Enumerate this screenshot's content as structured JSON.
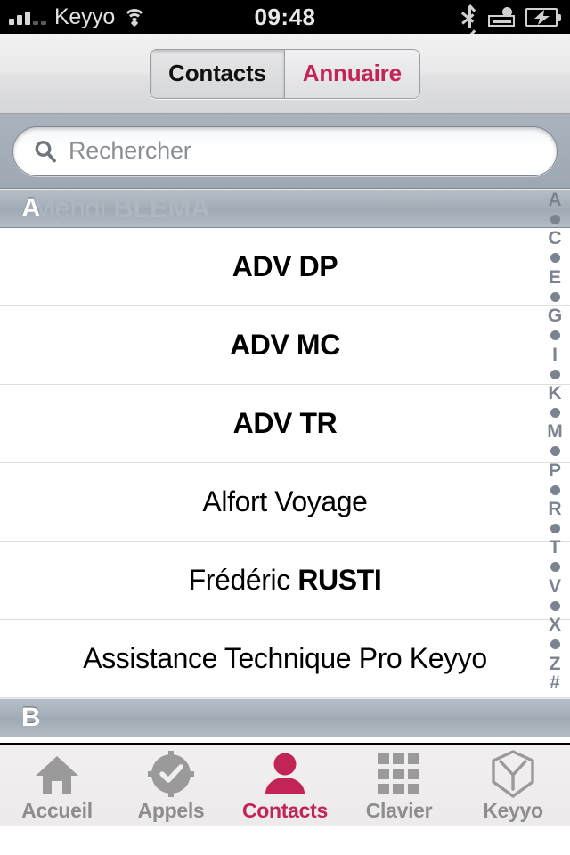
{
  "status_bar": {
    "carrier": "Keyyo",
    "time": "09:48",
    "signal_icon": "signal-bars-icon",
    "wifi_icon": "wifi-icon",
    "bluetooth_icon": "bluetooth-icon",
    "lock_icon": "lock-rotation-icon",
    "battery_icon": "battery-charging-icon"
  },
  "navbar": {
    "segments": [
      {
        "label": "Contacts",
        "selected": true
      },
      {
        "label": "Annuaire",
        "selected": false
      }
    ]
  },
  "search": {
    "placeholder": "Rechercher",
    "value": "",
    "icon": "search-icon"
  },
  "list": {
    "sections": [
      {
        "letter": "A",
        "ghost_row": {
          "first": "Mehdi ",
          "last": "BLEMA"
        },
        "rows": [
          {
            "first": "",
            "last": "ADV DP",
            "align": "center"
          },
          {
            "first": "",
            "last": "ADV MC",
            "align": "center"
          },
          {
            "first": "",
            "last": "ADV TR",
            "align": "center"
          },
          {
            "first": "Alfort Voyage",
            "last": "",
            "align": "center"
          },
          {
            "first": "Frédéric ",
            "last": "RUSTI",
            "align": "center"
          },
          {
            "first": "Assistance Technique Pro Keyyo",
            "last": "",
            "align": "center"
          }
        ]
      },
      {
        "letter": "B",
        "ghost_row": null,
        "rows": []
      }
    ]
  },
  "alpha_index": [
    "A",
    "•",
    "C",
    "•",
    "E",
    "•",
    "G",
    "•",
    "I",
    "•",
    "K",
    "•",
    "M",
    "•",
    "P",
    "•",
    "R",
    "•",
    "T",
    "•",
    "V",
    "•",
    "X",
    "•",
    "Z",
    "#"
  ],
  "tabbar": {
    "tabs": [
      {
        "label": "Accueil",
        "icon": "home-icon",
        "active": false
      },
      {
        "label": "Appels",
        "icon": "recents-clock-icon",
        "active": false
      },
      {
        "label": "Contacts",
        "icon": "person-icon",
        "active": true
      },
      {
        "label": "Clavier",
        "icon": "keypad-grid-icon",
        "active": false
      },
      {
        "label": "Keyyo",
        "icon": "cube-logo-icon",
        "active": false
      }
    ]
  },
  "colors": {
    "accent": "#c32456",
    "index_grey": "#7a838f",
    "tab_inactive": "#8d8d8d",
    "search_bg": "#a4adb8",
    "section_header": "#a4adb8"
  }
}
